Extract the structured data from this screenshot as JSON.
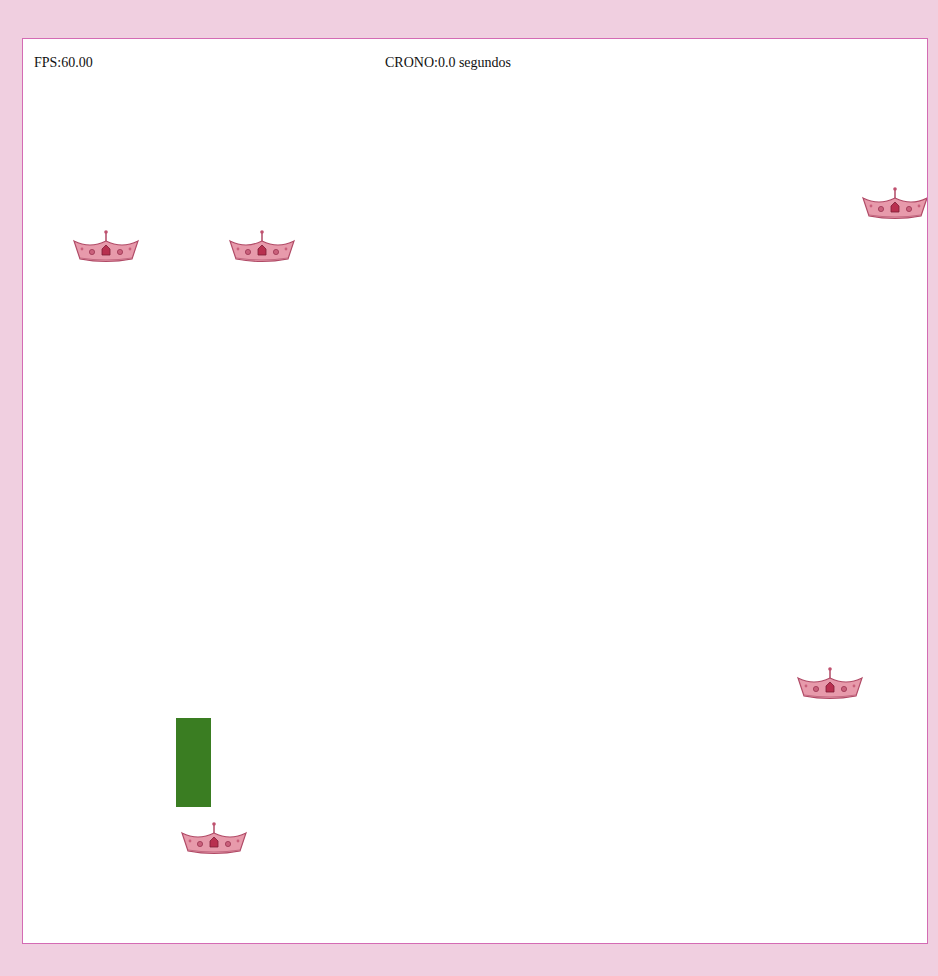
{
  "hud": {
    "fps": "FPS:60.00",
    "timer": "CRONO:0.0 segundos"
  }
}
